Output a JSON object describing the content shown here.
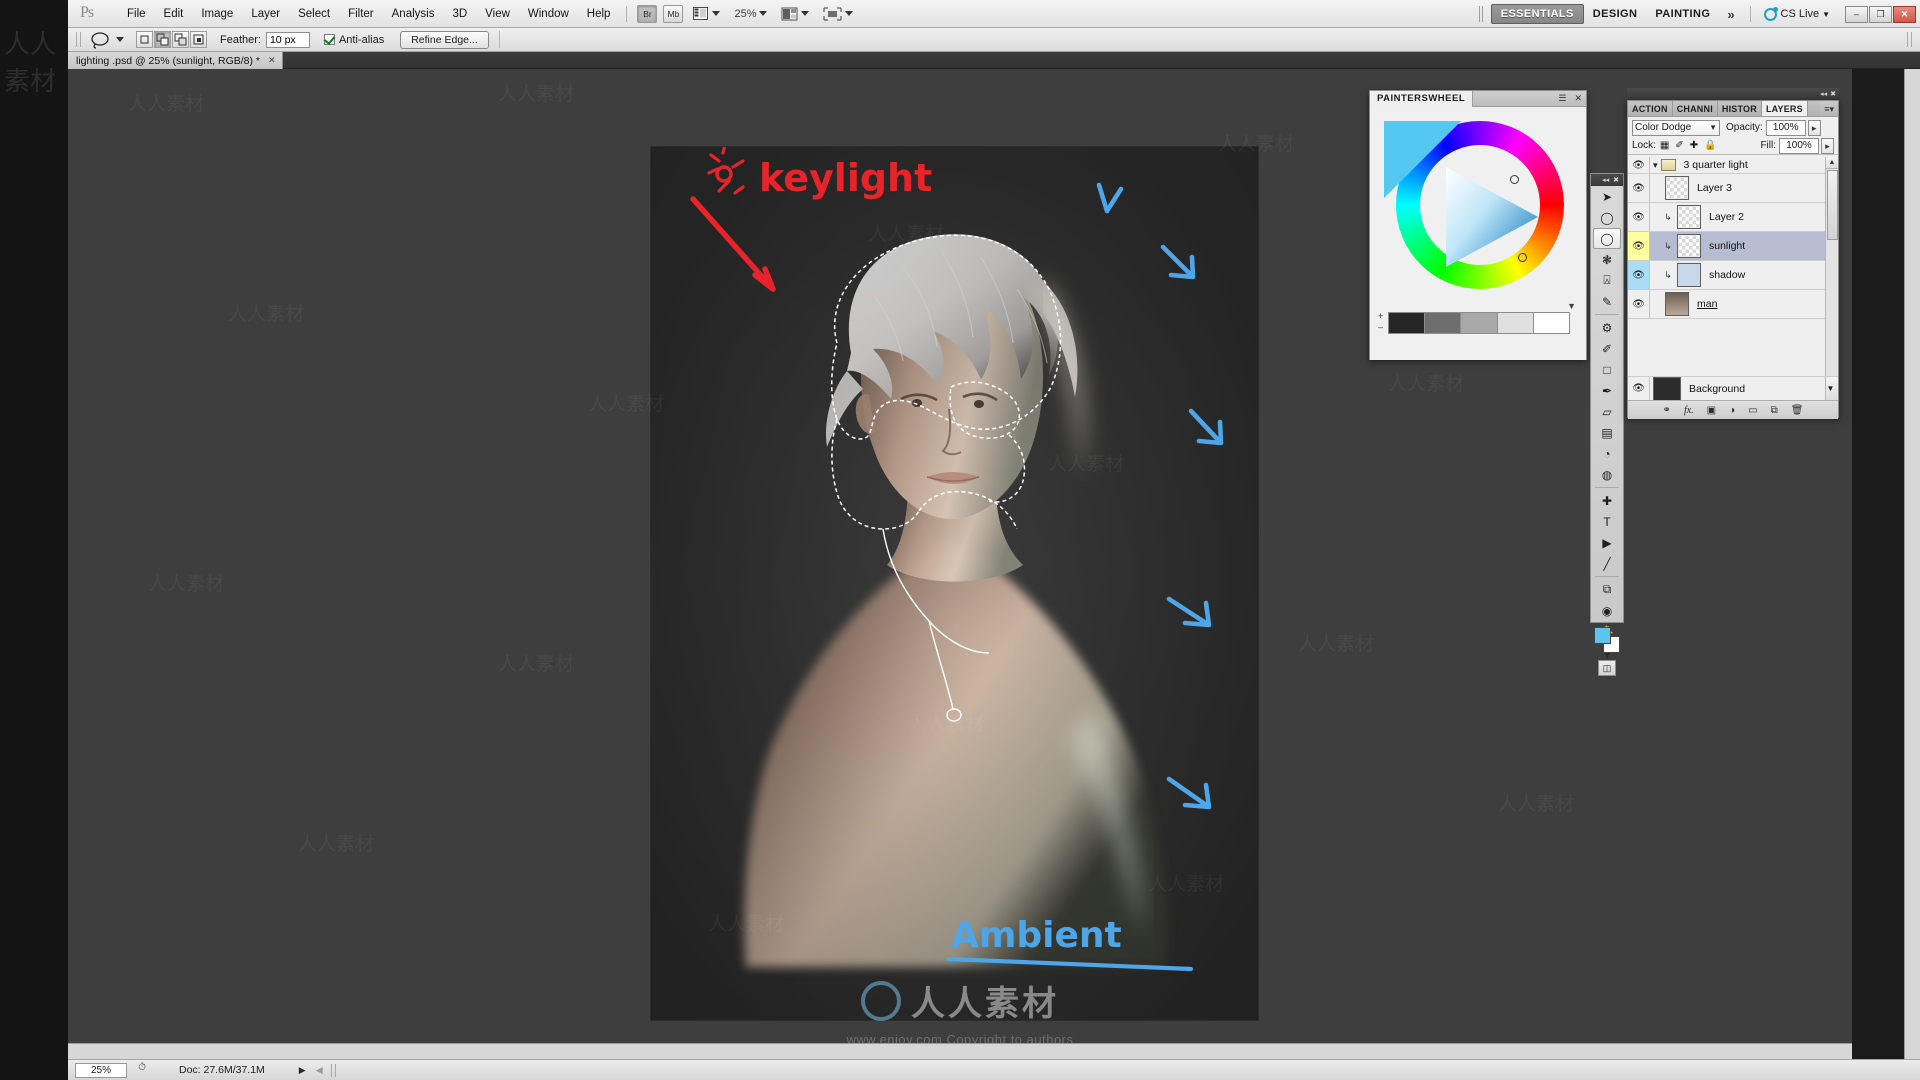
{
  "app": {
    "name": "Adobe Photoshop",
    "logo_text": "Ps"
  },
  "menubar": {
    "items": [
      {
        "label": "File"
      },
      {
        "label": "Edit"
      },
      {
        "label": "Image"
      },
      {
        "label": "Layer"
      },
      {
        "label": "Select"
      },
      {
        "label": "Filter"
      },
      {
        "label": "Analysis"
      },
      {
        "label": "3D"
      },
      {
        "label": "View"
      },
      {
        "label": "Window"
      },
      {
        "label": "Help"
      }
    ],
    "bridge_label": "Br",
    "minibridge_label": "Mb",
    "view_extras_icon": "screen-mode-icon",
    "zoom_level": "25%",
    "arrange_icon": "arrange-documents-icon",
    "screenmode_icon": "screen-mode-icon"
  },
  "workspace": {
    "tabs": [
      {
        "label": "ESSENTIALS",
        "active": true
      },
      {
        "label": "DESIGN",
        "active": false
      },
      {
        "label": "PAINTING",
        "active": false
      }
    ],
    "more_icon": "chevron-double-right-icon",
    "cs_live_label": "CS Live",
    "window_buttons": {
      "minimize": "–",
      "restore": "❐",
      "close": "✕"
    }
  },
  "options_bar": {
    "tool_icon": "lasso-tool-icon",
    "tool_preset_caret": "chevron-down-icon",
    "selection_modes": [
      {
        "name": "new-selection",
        "active": false
      },
      {
        "name": "add-to-selection",
        "active": true
      },
      {
        "name": "subtract-from-selection",
        "active": false
      },
      {
        "name": "intersect-with-selection",
        "active": false
      }
    ],
    "feather_label": "Feather:",
    "feather_value": "10 px",
    "antialias_label": "Anti-alias",
    "antialias_checked": true,
    "refine_edge_label": "Refine Edge..."
  },
  "document": {
    "tab_title": "lighting .psd @ 25% (sunlight, RGB/8) *",
    "close_icon": "close-icon"
  },
  "status_bar": {
    "zoom_value": "25%",
    "clock_icon": "timing-icon",
    "doc_info": "Doc: 27.6M/37.1M",
    "play_icon": "play-arrow-icon",
    "prev_icon": "prev-arrow-icon"
  },
  "painterswheel_panel": {
    "tab_label": "PAINTERSWHEEL",
    "menu_icon": "panel-menu-icon",
    "collapse_icon": "collapse-icon",
    "close_icon": "close-icon",
    "plus_label": "+",
    "minus_label": "–",
    "swatches": [
      "#262626",
      "#6e6e6e",
      "#a8a8a8",
      "#e0e0e0",
      "#ffffff"
    ],
    "value_arrow_icon": "triangle-down-icon",
    "selected_color": "#5cc4ee"
  },
  "tools_panel": {
    "collapse_icon": "collapse-icon",
    "expand_icon": "expand-icon",
    "items": [
      {
        "name": "move-tool",
        "glyph": "➤",
        "selected": false
      },
      {
        "name": "elliptical-marquee-tool",
        "glyph": "○",
        "selected": false
      },
      {
        "name": "lasso-tool",
        "glyph": "◯",
        "selected": true
      },
      {
        "name": "magic-wand-tool",
        "glyph": "✳",
        "selected": false
      },
      {
        "name": "crop-tool",
        "glyph": "⌗",
        "selected": false
      },
      {
        "name": "eyedropper-tool",
        "glyph": "✒",
        "selected": false
      },
      {
        "name": "healing-brush-tool",
        "glyph": "☙",
        "selected": false
      },
      {
        "name": "brush-tool",
        "glyph": "✎",
        "selected": false
      },
      {
        "name": "stamp-tool",
        "glyph": "⚑",
        "selected": false
      },
      {
        "name": "history-brush-tool",
        "glyph": "✐",
        "selected": false
      },
      {
        "name": "eraser-tool",
        "glyph": "▱",
        "selected": false
      },
      {
        "name": "gradient-tool",
        "glyph": "▤",
        "selected": false
      },
      {
        "name": "blur-tool",
        "glyph": "◔",
        "selected": false
      },
      {
        "name": "dodge-tool",
        "glyph": "◍",
        "selected": false
      },
      {
        "name": "pen-tool",
        "glyph": "✒",
        "selected": false
      },
      {
        "name": "type-tool",
        "glyph": "T",
        "selected": false
      },
      {
        "name": "path-selection-tool",
        "glyph": "▶",
        "selected": false
      },
      {
        "name": "shape-tool",
        "glyph": "╱",
        "selected": false
      },
      {
        "name": "3d-rotate-tool",
        "glyph": "⧉",
        "selected": false
      },
      {
        "name": "3d-orbit-tool",
        "glyph": "⊕",
        "selected": false
      },
      {
        "name": "hand-tool",
        "glyph": "✋",
        "selected": false
      },
      {
        "name": "zoom-tool",
        "glyph": "⚲",
        "selected": false
      }
    ],
    "foreground_color": "#5cc4ee",
    "background_color": "#ffffff",
    "quickmask_icon": "quick-mask-icon"
  },
  "layers_panel": {
    "collapse_icon": "collapse-icon",
    "close_icon": "close-icon",
    "tabs": [
      {
        "label": "ACTION",
        "active": false
      },
      {
        "label": "CHANNI",
        "active": false
      },
      {
        "label": "HISTOR",
        "active": false
      },
      {
        "label": "LAYERS",
        "active": true
      }
    ],
    "menu_icon": "panel-menu-icon",
    "blend_mode": "Color Dodge",
    "blend_mode_caret": "chevron-down-icon",
    "opacity_label": "Opacity:",
    "opacity_value": "100%",
    "lock_label": "Lock:",
    "lock_icons": [
      {
        "name": "lock-transparent-pixels-icon",
        "glyph": "▨"
      },
      {
        "name": "lock-image-pixels-icon",
        "glyph": "✎"
      },
      {
        "name": "lock-position-icon",
        "glyph": "✜"
      },
      {
        "name": "lock-all-icon",
        "glyph": "ὑ2"
      }
    ],
    "fill_label": "Fill:",
    "fill_value": "100%",
    "layers": [
      {
        "name": "3 quarter light",
        "type": "group",
        "visible": true,
        "selected": false,
        "expanded": true,
        "thumb": "folder"
      },
      {
        "name": "Layer 3",
        "type": "layer",
        "visible": true,
        "selected": false,
        "clipped": false,
        "thumb": "transparent"
      },
      {
        "name": "Layer 2",
        "type": "layer",
        "visible": true,
        "selected": false,
        "clipped": true,
        "thumb": "transparent"
      },
      {
        "name": "sunlight",
        "type": "layer",
        "visible": true,
        "selected": true,
        "clipped": true,
        "thumb": "transparent",
        "eye_highlight": "#ffff9e"
      },
      {
        "name": "shadow",
        "type": "layer",
        "visible": true,
        "selected": false,
        "clipped": true,
        "thumb": "solid",
        "eye_highlight": "#aaddf5"
      },
      {
        "name": "man",
        "type": "layer",
        "visible": true,
        "selected": false,
        "clipped": false,
        "thumb": "image",
        "underline": true
      },
      {
        "name": "Background",
        "type": "layer",
        "visible": true,
        "selected": false,
        "clipped": false,
        "thumb": "dark"
      }
    ],
    "scroll_up_icon": "scroll-up-arrow",
    "scroll_down_icon": "scroll-down-arrow",
    "footer_buttons": [
      {
        "name": "link-layers-button",
        "glyph": "⚭"
      },
      {
        "name": "layer-style-button",
        "glyph": "fx."
      },
      {
        "name": "layer-mask-button",
        "glyph": "▢"
      },
      {
        "name": "adjustment-layer-button",
        "glyph": "◑"
      },
      {
        "name": "new-group-button",
        "glyph": "▭"
      },
      {
        "name": "new-layer-button",
        "glyph": "⧉"
      },
      {
        "name": "delete-layer-button",
        "glyph": "☒"
      }
    ]
  },
  "canvas": {
    "annotations": [
      {
        "text": "keylight",
        "color": "#e8232a",
        "name": "keylight-annotation"
      },
      {
        "text": "Ambient",
        "color": "#4ea6e8",
        "name": "ambient-annotation"
      }
    ],
    "arrow_color_key": "#e8232a",
    "arrow_color_ambient": "#4ea6e8",
    "selection_style": "marching-ants"
  },
  "watermarks": {
    "tile_text": "人人素材",
    "center_text": "人人素材",
    "url_text": "www.enjoy.com  Copyright to authors"
  }
}
